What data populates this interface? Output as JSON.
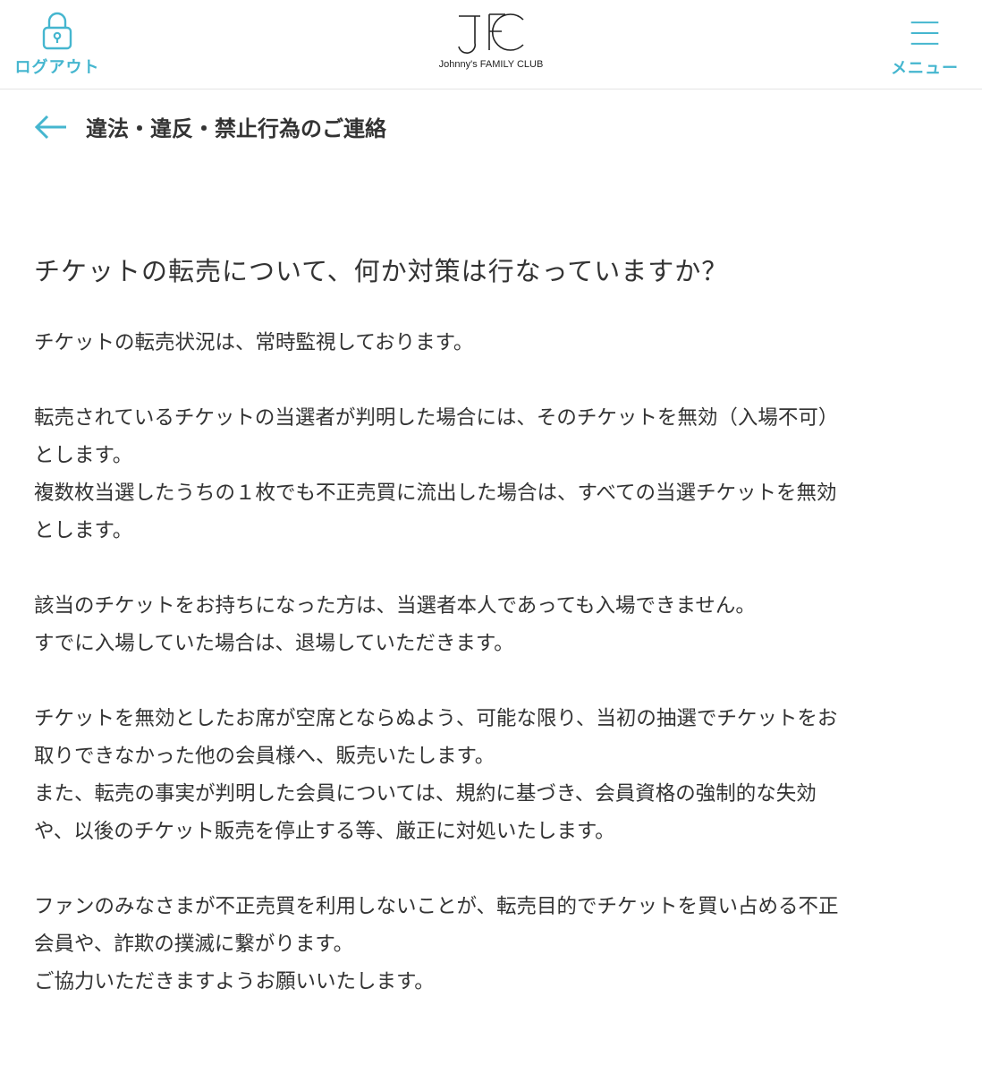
{
  "header": {
    "logout_label": "ログアウト",
    "logout_icon": "lock-icon",
    "logo_mark": "JFC",
    "logo_text": "Johnny's FAMILY CLUB",
    "menu_label": "メニュー",
    "menu_icon": "hamburger-icon"
  },
  "page": {
    "back_icon": "back-arrow-icon",
    "title": "違法・違反・禁止行為のご連絡"
  },
  "content": {
    "question": "チケットの転売について、何か対策は行なっていますか？",
    "paragraphs": [
      [
        "チケットの転売状況は、常時監視しております。"
      ],
      [
        "転売されているチケットの当選者が判明した場合には、そのチケットを無効（入場不可）",
        "とします。",
        "複数枚当選したうちの１枚でも不正売買に流出した場合は、すべての当選チケットを無効",
        "とします。"
      ],
      [
        "該当のチケットをお持ちになった方は、当選者本人であっても入場できません。",
        "すでに入場していた場合は、退場していただきます。"
      ],
      [
        "チケットを無効としたお席が空席とならぬよう、可能な限り、当初の抽選でチケットをお",
        "取りできなかった他の会員様へ、販売いたします。",
        "また、転売の事実が判明した会員については、規約に基づき、会員資格の強制的な失効",
        "や、以後のチケット販売を停止する等、厳正に対処いたします。"
      ],
      [
        "ファンのみなさまが不正売買を利用しないことが、転売目的でチケットを買い占める不正",
        "会員や、詐欺の撲滅に繋がります。",
        "ご協力いただきますようお願いいたします。"
      ]
    ]
  },
  "colors": {
    "accent": "#45b6cf",
    "text": "#333333",
    "divider": "#e4e4e4"
  }
}
